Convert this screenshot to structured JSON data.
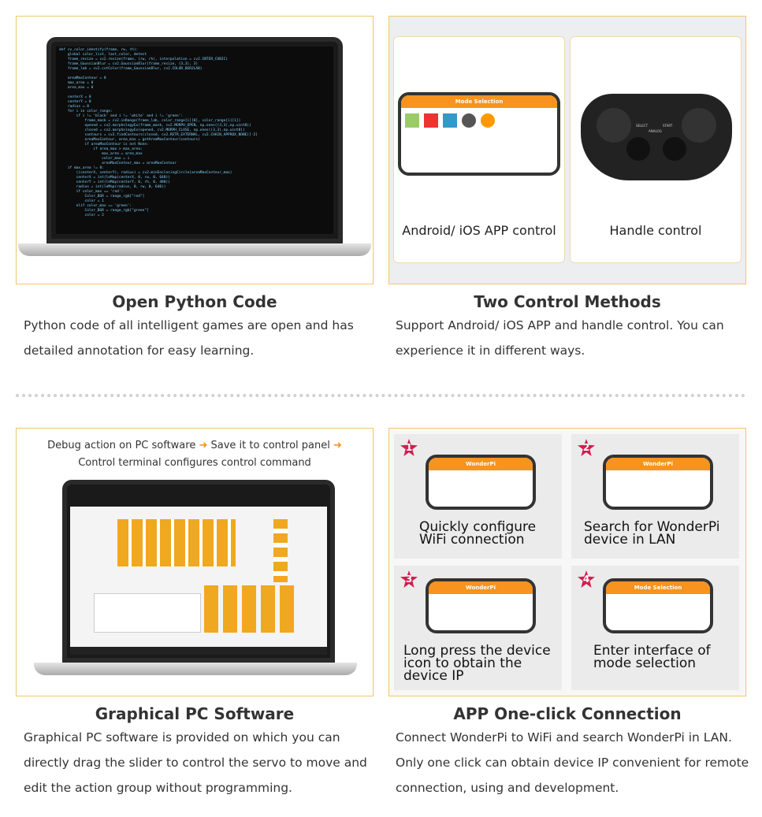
{
  "features": [
    {
      "title": "Open Python Code",
      "lines": [
        "Python code of all intelligent games are open and has",
        "detailed annotation for easy learning."
      ]
    },
    {
      "title": "Two Control Methods",
      "lines": [
        "Support Android/ iOS APP and handle control. You can",
        "experience it in different ways."
      ],
      "image": {
        "left_caption": "Android/ iOS APP control",
        "right_caption": "Handle control",
        "app_bar": "Mode Selection",
        "controller_labels": [
          "SELECT",
          "START",
          "ANALOG"
        ]
      }
    },
    {
      "title": "Graphical PC Software",
      "lines": [
        "Graphical PC software is provided on which you can",
        "directly drag the slider to control the servo to move and",
        "edit the action group without programming."
      ],
      "image": {
        "line1_a": "Debug action on PC software",
        "line1_b": "Save it to control panel",
        "line2": "Control terminal configures control command"
      }
    },
    {
      "title": "APP One-click Connection",
      "lines": [
        "Connect WonderPi to WiFi and search WonderPi in LAN.",
        "Only one click can obtain device IP convenient for remote",
        "connection, using and development."
      ],
      "image": {
        "steps": [
          {
            "num": "1",
            "bar": "WonderPi",
            "lines": [
              "Quickly configure",
              "WiFi connection"
            ]
          },
          {
            "num": "2",
            "bar": "WonderPi",
            "lines": [
              "Search for WonderPi",
              "device in LAN"
            ]
          },
          {
            "num": "3",
            "bar": "WonderPi",
            "lines": [
              "Long press the device",
              "icon to obtain the",
              "device IP"
            ]
          },
          {
            "num": "4",
            "bar": "Mode Selection",
            "lines": [
              "Enter interface of",
              "mode selection"
            ]
          }
        ]
      }
    }
  ],
  "colors": {
    "card_border": "#f2c56e",
    "accent": "#f7931e",
    "step_badge": "#d01f4f"
  }
}
